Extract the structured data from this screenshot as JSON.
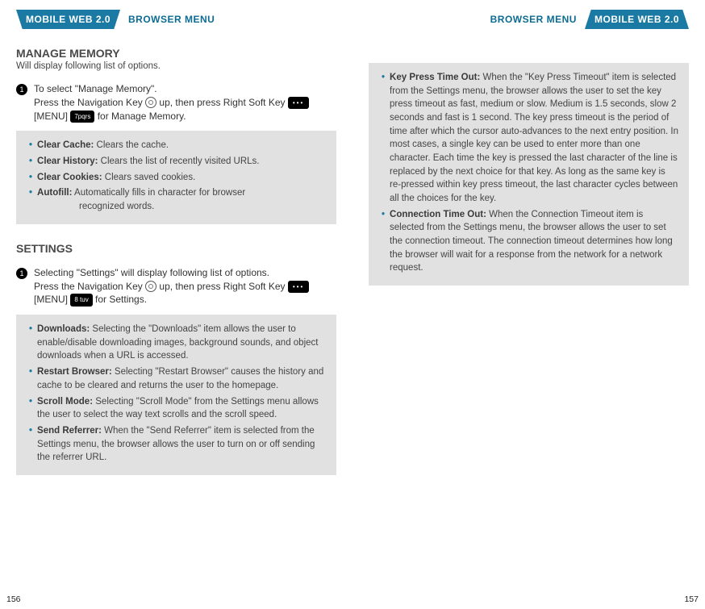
{
  "header": {
    "tab": "MOBILE WEB 2.0",
    "title": "BROWSER MENU"
  },
  "left": {
    "section1": {
      "title": "MANAGE MEMORY",
      "subtitle": "Will display following list of options.",
      "step1_line1": "To select \"Manage Memory\".",
      "step1_line2a": "Press the Navigation Key ",
      "step1_line2b": " up, then press Right Soft Key ",
      "step1_line2c": " [MENU] ",
      "step1_line2d": " for Manage Memory.",
      "step1_keycap": "7pqrs",
      "box1": {
        "i1_lbl": "Clear Cache:",
        "i1_txt": "Clears the cache.",
        "i2_lbl": "Clear History:",
        "i2_txt": "Clears the list of recently visited URLs.",
        "i3_lbl": "Clear Cookies:",
        "i3_txt": "Clears saved cookies.",
        "i4_lbl": "Autofill:",
        "i4_txt": "Automatically fills in character for browser",
        "i4_cont": "recognized words."
      }
    },
    "section2": {
      "title": "SETTINGS",
      "step1_line1": "Selecting \"Settings\" will display following list of options.",
      "step1_line2a": "Press the Navigation Key ",
      "step1_line2b": " up, then press Right Soft Key ",
      "step1_line2c": " [MENU] ",
      "step1_line2d": " for Settings.",
      "step1_keycap": "8 tuv",
      "box2": {
        "i1_lbl": "Downloads:",
        "i1_txt": "Selecting the \"Downloads\" item allows the user to enable/disable downloading images, background sounds, and object downloads when a URL is accessed.",
        "i2_lbl": "Restart Browser:",
        "i2_txt": "Selecting \"Restart Browser\" causes the history and cache to be cleared and returns the user to the homepage.",
        "i3_lbl": "Scroll Mode:",
        "i3_txt": "Selecting \"Scroll Mode\" from the Settings menu allows the user to select the way text scrolls and the scroll speed.",
        "i4_lbl": "Send Referrer:",
        "i4_txt": "When the \"Send Referrer\" item is selected from the Settings menu, the browser allows the user to turn on or off sending the referrer URL."
      }
    },
    "pageNum": "156"
  },
  "right": {
    "box": {
      "i1_lbl": "Key Press Time Out:",
      "i1_txt": "When the \"Key Press Timeout\" item is selected from the Settings menu, the browser allows the user to set the key press timeout as fast, medium or slow. Medium is 1.5 seconds, slow 2 seconds and fast is 1 second. The key press timeout is the period of time after which the cursor auto-advances to the next entry position. In most cases, a single key can be used to enter more than one character. Each time the key is pressed the last character of the line is replaced by the next choice for that key. As long as the same key is re-pressed within key press timeout, the last character cycles between all the choices for the key.",
      "i2_lbl": "Connection Time Out:",
      "i2_txt": "When the Connection Timeout item is selected from the Settings menu, the browser allows the user to set the connection timeout. The connection timeout determines how long the browser will wait for a response from the network for a network request."
    },
    "pageNum": "157"
  }
}
